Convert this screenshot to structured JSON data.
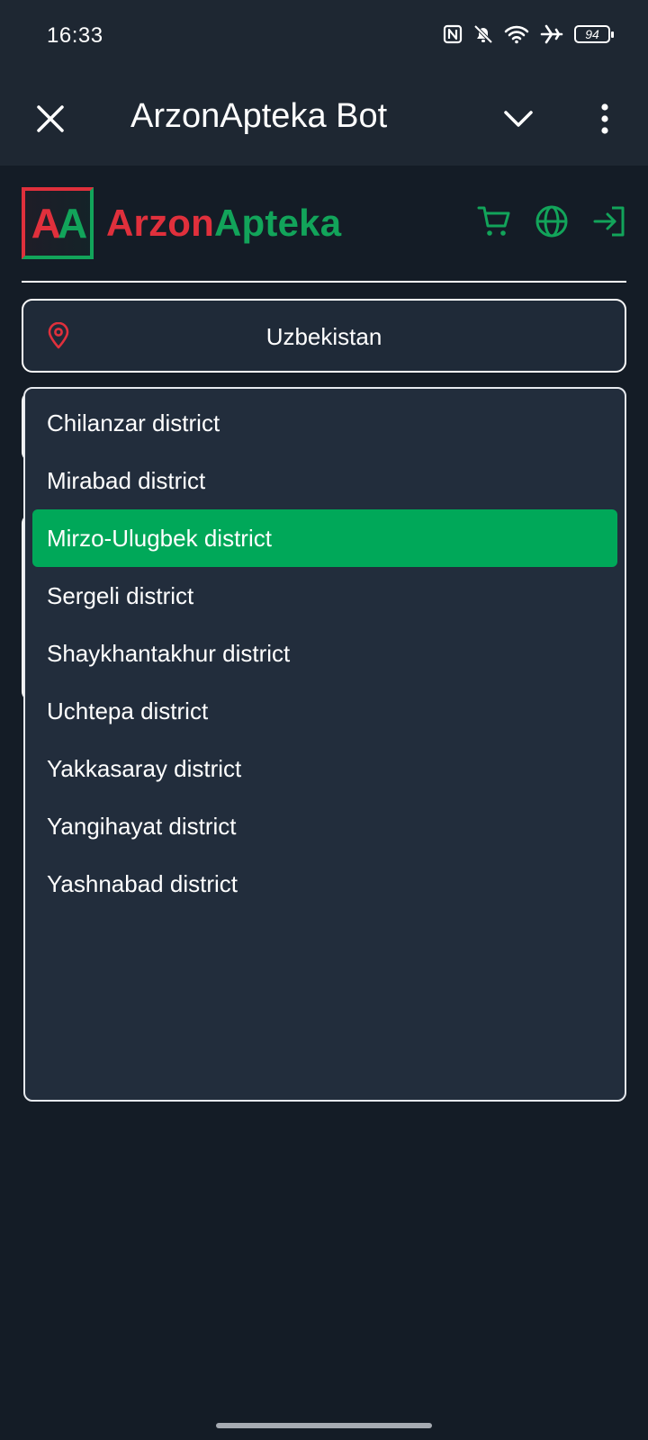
{
  "status_bar": {
    "time": "16:33",
    "battery": "94",
    "icons": [
      "nfc-icon",
      "bell-off-icon",
      "wifi-icon",
      "airplane-icon",
      "battery-icon"
    ]
  },
  "app_bar": {
    "title": "ArzonApteka Bot",
    "icons": [
      "close-icon",
      "chevron-down-icon",
      "more-vert-icon"
    ]
  },
  "header": {
    "logo_mark_1": "A",
    "logo_mark_2": "A",
    "logo_text_1": "Arzon",
    "logo_text_2": "Apteka",
    "actions": [
      "cart-icon",
      "globe-icon",
      "login-icon"
    ]
  },
  "location": {
    "value": "Uzbekistan",
    "icon": "map-pin-icon"
  },
  "dropdown": {
    "items": [
      "Chilanzar district",
      "Mirabad district",
      "Mirzo-Ulugbek district",
      "Sergeli district",
      "Shaykhantakhur district",
      "Uchtepa district",
      "Yakkasaray district",
      "Yangihayat district",
      "Yashnabad district"
    ],
    "selected": "Mirzo-Ulugbek district"
  },
  "colors": {
    "accent_green": "#00a859",
    "brand_red": "#e0303c",
    "brand_green": "#12a45a",
    "background": "#141c26",
    "surface": "#222d3c",
    "app_bar": "#1e2732"
  }
}
